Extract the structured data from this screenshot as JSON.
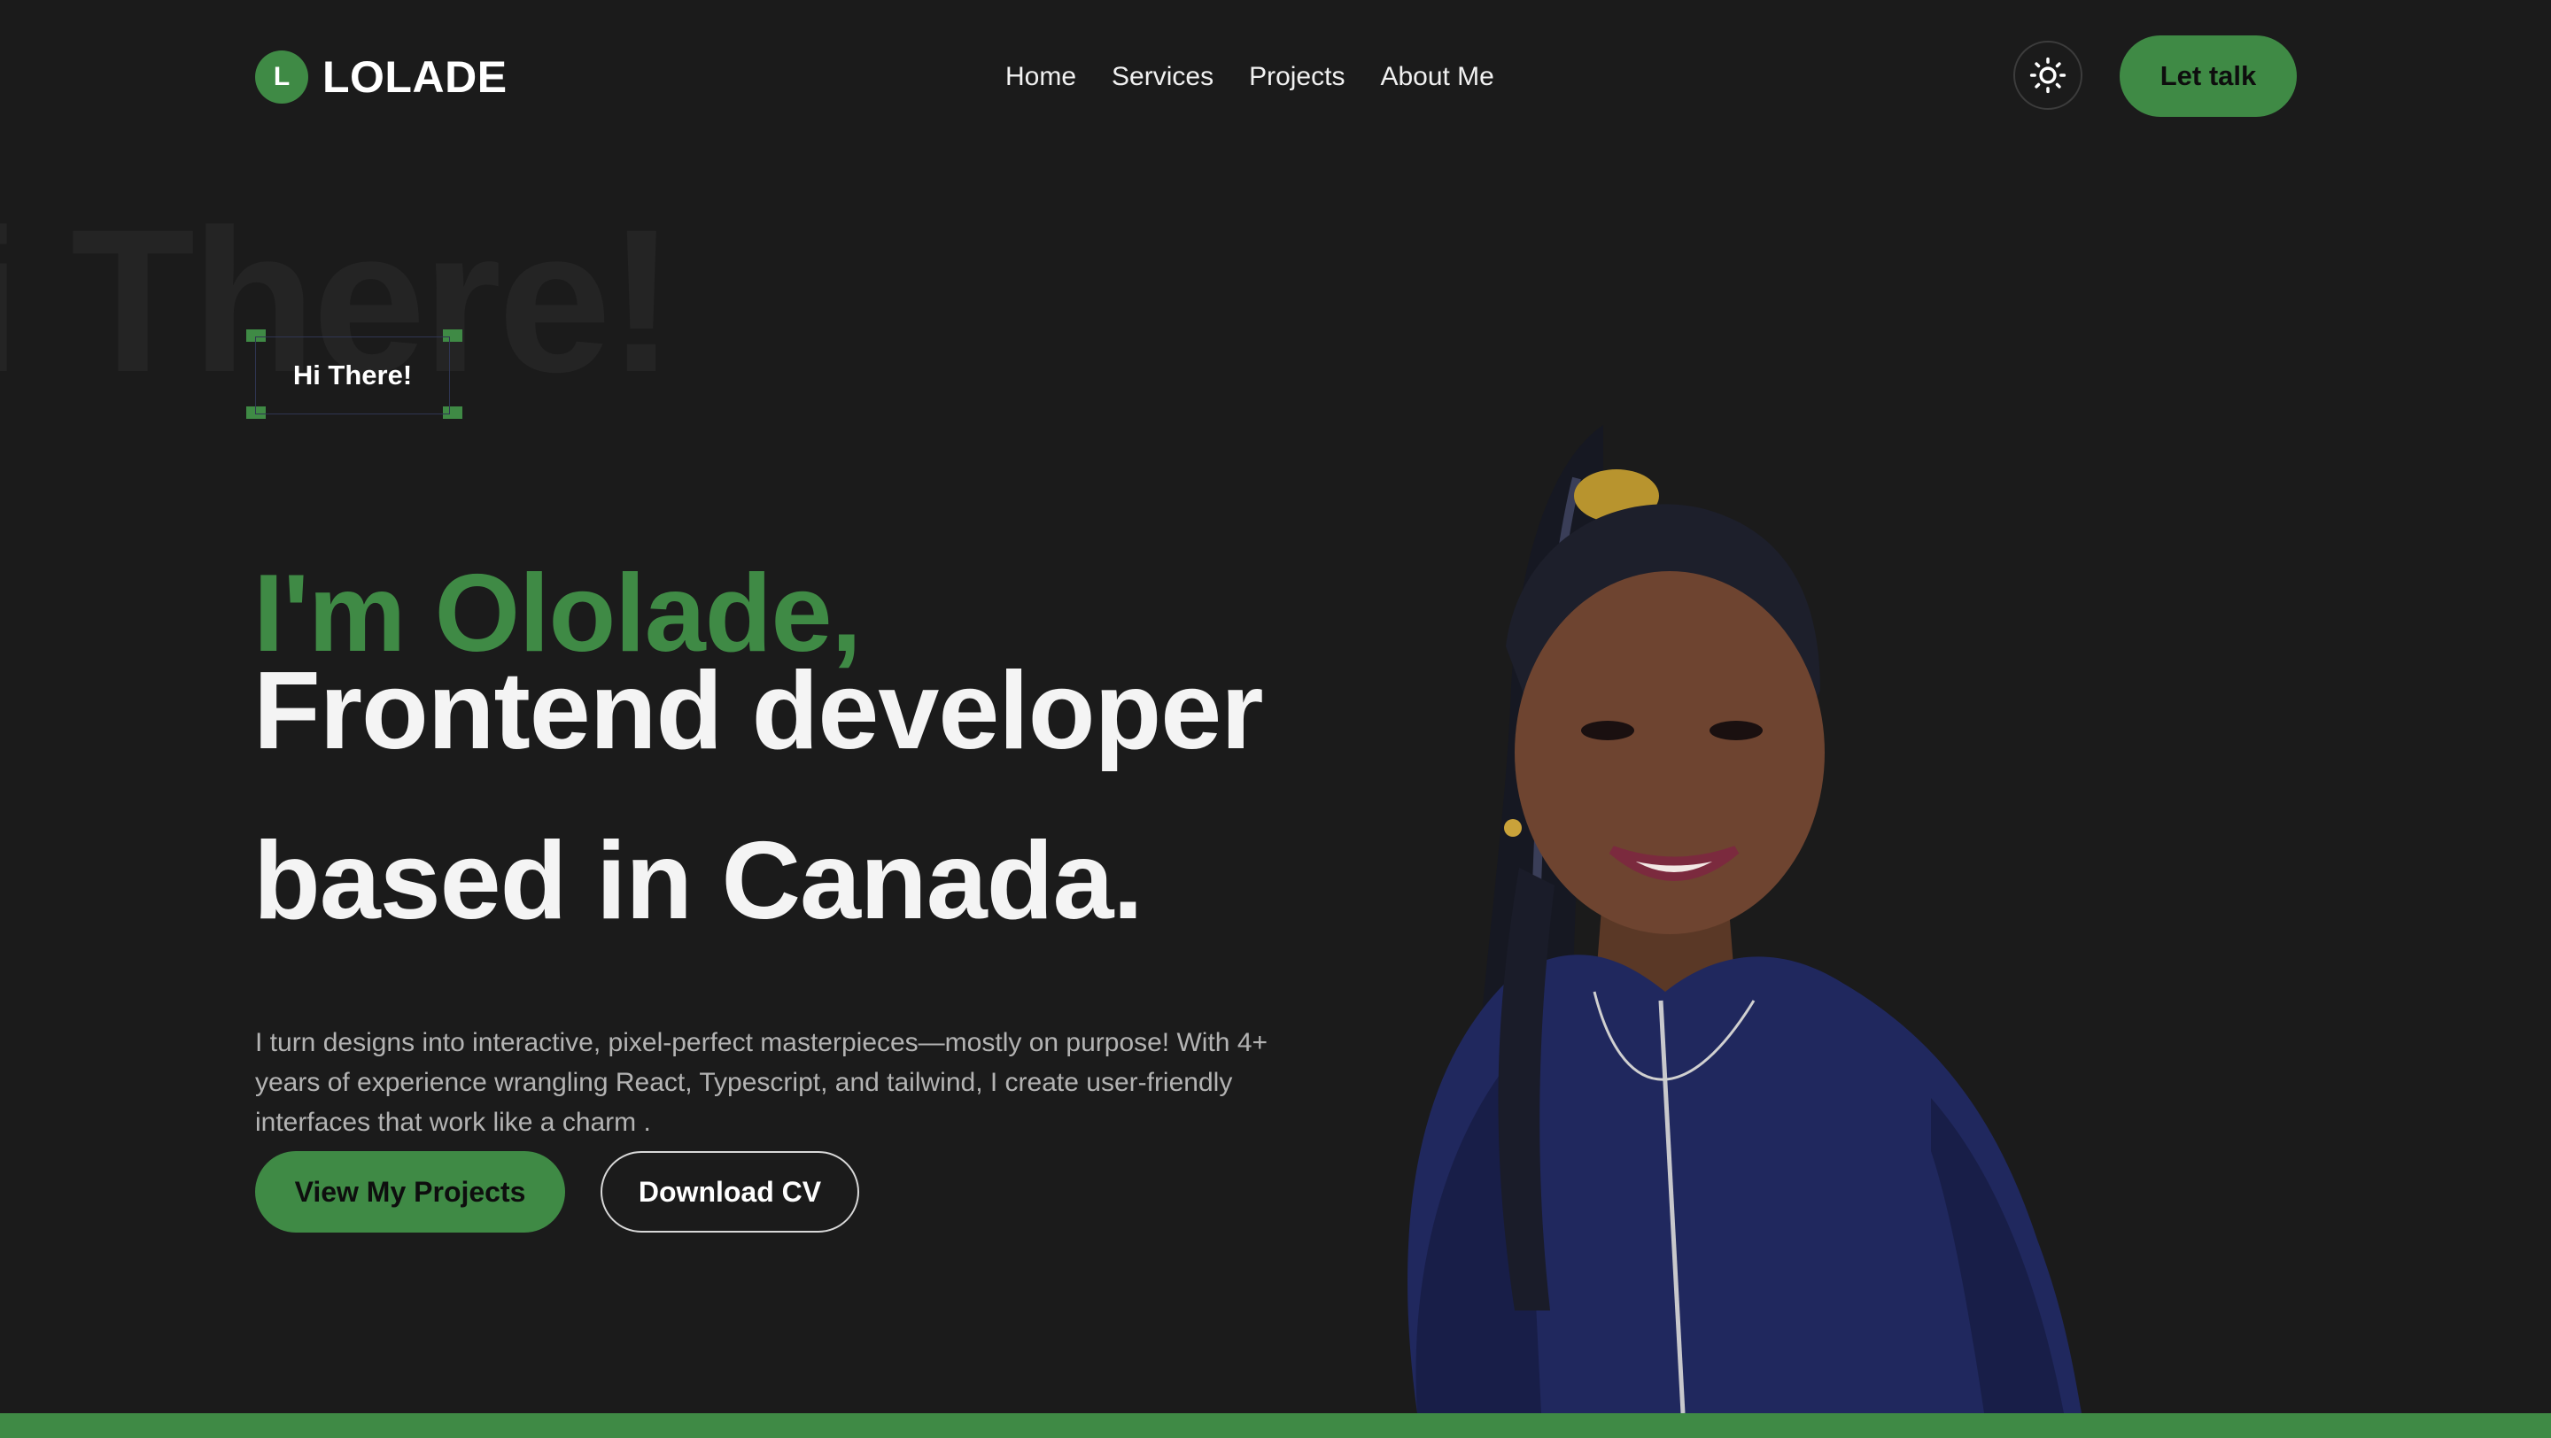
{
  "brand": {
    "initial": "L",
    "name": "LOLADE"
  },
  "nav": {
    "items": [
      {
        "label": "Home"
      },
      {
        "label": "Services"
      },
      {
        "label": "Projects"
      },
      {
        "label": "About Me"
      }
    ],
    "theme_toggle_icon": "sun-icon",
    "cta_label": "Let talk"
  },
  "hero": {
    "ghost_text": "i There!",
    "tag": "Hi There!",
    "name_line": "I'm Ololade,",
    "title_line1": "Frontend developer",
    "title_line2": "based in Canada.",
    "description": "I turn designs into interactive, pixel-perfect masterpieces—mostly on purpose! With 4+ years of experience wrangling React, Typescript, and tailwind, I create user-friendly interfaces that work like a charm .",
    "primary_button": "View My Projects",
    "secondary_button": "Download CV"
  },
  "colors": {
    "background": "#1b1b1b",
    "accent": "#3f8a45",
    "text": "#ffffff",
    "muted_text": "#b3b3b3"
  }
}
